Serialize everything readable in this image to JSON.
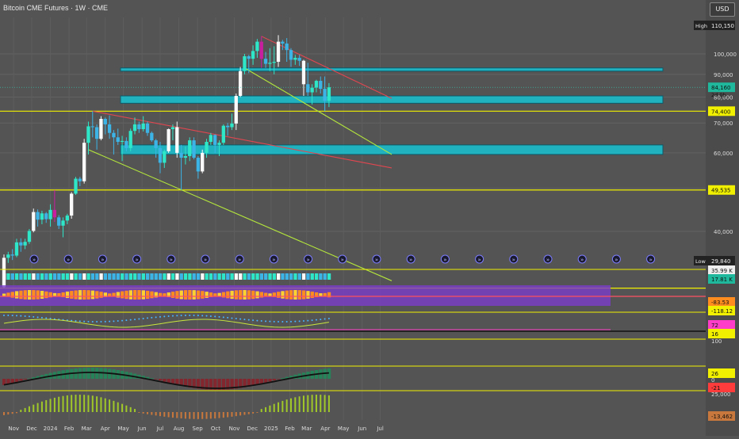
{
  "header": {
    "title": "Bitcoin CME Futures · 1W · CME",
    "currency": "USD"
  },
  "colors": {
    "background": "#545454",
    "bull": "#2ee6c8",
    "bear": "#3cb4e6",
    "neutral_candle": "#fafafa",
    "magenta_candle": "#c81ea0",
    "yellow_line": "#f0f000",
    "red_line": "#e14650",
    "green_line": "#b4e63c",
    "zone_fill": "#19c3d2"
  },
  "chart_data": {
    "type": "candlestick",
    "title": "Bitcoin CME Futures · 1W · CME",
    "x_labels": [
      "Nov",
      "Dec",
      "2024",
      "Feb",
      "Mar",
      "Apr",
      "May",
      "Jun",
      "Jul",
      "Aug",
      "Sep",
      "Oct",
      "Nov",
      "Dec",
      "2025",
      "Feb",
      "Mar",
      "Apr",
      "May",
      "Jun",
      "Jul"
    ],
    "y_ticks": [
      40000,
      50000,
      60000,
      70000,
      80000,
      90000,
      100000
    ],
    "y_tick_labels": [
      "40,000",
      "50,000",
      "60,000",
      "70,000",
      "80,000",
      "90,000",
      "100,000"
    ],
    "log_scale": true,
    "grid": true,
    "price_labels": [
      {
        "label": "High",
        "value": "110,150"
      },
      {
        "label": "",
        "value": "84,160"
      },
      {
        "label": "",
        "value": "2d 0h"
      },
      {
        "label": "",
        "value": "74,400"
      },
      {
        "label": "",
        "value": "49,535"
      },
      {
        "label": "Low",
        "value": "29,840"
      }
    ],
    "horizontal_lines": [
      74400,
      49535,
      29840
    ],
    "zones": [
      {
        "low": 91500,
        "high": 93000
      },
      {
        "low": 77500,
        "high": 80500
      },
      {
        "low": 59500,
        "high": 62500
      }
    ],
    "candles": [
      {
        "date": "2023-10-16",
        "o": 30000,
        "h": 35500,
        "l": 29840,
        "c": 34900
      },
      {
        "date": "2023-10-23",
        "o": 34900,
        "h": 36000,
        "l": 34000,
        "c": 35500
      },
      {
        "date": "2023-10-30",
        "o": 35500,
        "h": 36500,
        "l": 34500,
        "c": 35300
      },
      {
        "date": "2023-11-06",
        "o": 35300,
        "h": 38500,
        "l": 35000,
        "c": 37800
      },
      {
        "date": "2023-11-13",
        "o": 37800,
        "h": 38600,
        "l": 36000,
        "c": 37200
      },
      {
        "date": "2023-11-20",
        "o": 37200,
        "h": 38500,
        "l": 36500,
        "c": 37900
      },
      {
        "date": "2023-11-27",
        "o": 37900,
        "h": 40500,
        "l": 37500,
        "c": 40100
      },
      {
        "date": "2023-12-04",
        "o": 40100,
        "h": 45000,
        "l": 39800,
        "c": 44200
      },
      {
        "date": "2023-12-11",
        "o": 44200,
        "h": 44800,
        "l": 41000,
        "c": 42500
      },
      {
        "date": "2023-12-18",
        "o": 42500,
        "h": 44500,
        "l": 41500,
        "c": 43900
      },
      {
        "date": "2023-12-25",
        "o": 43900,
        "h": 44200,
        "l": 41800,
        "c": 42600
      },
      {
        "date": "2024-01-01",
        "o": 42600,
        "h": 46000,
        "l": 41000,
        "c": 44700
      },
      {
        "date": "2024-01-08",
        "o": 44700,
        "h": 49500,
        "l": 42000,
        "c": 43000
      },
      {
        "date": "2024-01-15",
        "o": 43000,
        "h": 43500,
        "l": 40500,
        "c": 41200
      },
      {
        "date": "2024-01-22",
        "o": 41200,
        "h": 43000,
        "l": 38800,
        "c": 42300
      },
      {
        "date": "2024-01-29",
        "o": 42300,
        "h": 43800,
        "l": 41500,
        "c": 43400
      },
      {
        "date": "2024-02-05",
        "o": 43400,
        "h": 49000,
        "l": 42700,
        "c": 48600
      },
      {
        "date": "2024-02-12",
        "o": 48600,
        "h": 53000,
        "l": 48300,
        "c": 52500
      },
      {
        "date": "2024-02-19",
        "o": 52500,
        "h": 53000,
        "l": 50500,
        "c": 51800
      },
      {
        "date": "2024-02-26",
        "o": 51800,
        "h": 64500,
        "l": 51200,
        "c": 63200
      },
      {
        "date": "2024-03-04",
        "o": 63200,
        "h": 70500,
        "l": 59500,
        "c": 68800
      },
      {
        "date": "2024-03-11",
        "o": 68800,
        "h": 74400,
        "l": 65000,
        "c": 68500
      },
      {
        "date": "2024-03-18",
        "o": 68500,
        "h": 69500,
        "l": 61000,
        "c": 64500
      },
      {
        "date": "2024-03-25",
        "o": 64500,
        "h": 72500,
        "l": 64000,
        "c": 71500
      },
      {
        "date": "2024-04-01",
        "o": 71500,
        "h": 72000,
        "l": 66000,
        "c": 69500
      },
      {
        "date": "2024-04-08",
        "o": 69500,
        "h": 72800,
        "l": 64500,
        "c": 66500
      },
      {
        "date": "2024-04-15",
        "o": 66500,
        "h": 67500,
        "l": 59500,
        "c": 65000
      },
      {
        "date": "2024-04-22",
        "o": 65000,
        "h": 68000,
        "l": 62500,
        "c": 63500
      },
      {
        "date": "2024-04-29",
        "o": 63500,
        "h": 65500,
        "l": 57500,
        "c": 63800
      },
      {
        "date": "2024-05-06",
        "o": 63800,
        "h": 65000,
        "l": 60500,
        "c": 61500
      },
      {
        "date": "2024-05-13",
        "o": 61500,
        "h": 68000,
        "l": 60500,
        "c": 67200
      },
      {
        "date": "2024-05-20",
        "o": 67200,
        "h": 72000,
        "l": 66000,
        "c": 69500
      },
      {
        "date": "2024-05-27",
        "o": 69500,
        "h": 70500,
        "l": 66500,
        "c": 67800
      },
      {
        "date": "2024-06-03",
        "o": 67800,
        "h": 72500,
        "l": 67000,
        "c": 69800
      },
      {
        "date": "2024-06-10",
        "o": 69800,
        "h": 70500,
        "l": 65500,
        "c": 66500
      },
      {
        "date": "2024-06-17",
        "o": 66500,
        "h": 67000,
        "l": 63500,
        "c": 64000
      },
      {
        "date": "2024-06-24",
        "o": 64000,
        "h": 64500,
        "l": 58500,
        "c": 61500
      },
      {
        "date": "2024-07-01",
        "o": 61500,
        "h": 63500,
        "l": 54000,
        "c": 57000
      },
      {
        "date": "2024-07-08",
        "o": 57000,
        "h": 61000,
        "l": 55500,
        "c": 60500
      },
      {
        "date": "2024-07-15",
        "o": 60500,
        "h": 68000,
        "l": 60000,
        "c": 67800
      },
      {
        "date": "2024-07-22",
        "o": 67800,
        "h": 69500,
        "l": 64000,
        "c": 68500
      },
      {
        "date": "2024-07-29",
        "o": 68500,
        "h": 70500,
        "l": 58500,
        "c": 60000
      },
      {
        "date": "2024-08-05",
        "o": 60000,
        "h": 62500,
        "l": 49535,
        "c": 58500
      },
      {
        "date": "2024-08-12",
        "o": 58500,
        "h": 62000,
        "l": 56500,
        "c": 59000
      },
      {
        "date": "2024-08-19",
        "o": 59000,
        "h": 65000,
        "l": 57500,
        "c": 64000
      },
      {
        "date": "2024-08-26",
        "o": 64000,
        "h": 65000,
        "l": 58000,
        "c": 58500
      },
      {
        "date": "2024-09-02",
        "o": 58500,
        "h": 59000,
        "l": 52500,
        "c": 54500
      },
      {
        "date": "2024-09-09",
        "o": 54500,
        "h": 61000,
        "l": 54000,
        "c": 60000
      },
      {
        "date": "2024-09-16",
        "o": 60000,
        "h": 64500,
        "l": 58500,
        "c": 63500
      },
      {
        "date": "2024-09-23",
        "o": 63500,
        "h": 66500,
        "l": 62500,
        "c": 65800
      },
      {
        "date": "2024-09-30",
        "o": 65800,
        "h": 66000,
        "l": 60000,
        "c": 62500
      },
      {
        "date": "2024-10-07",
        "o": 62500,
        "h": 64000,
        "l": 59000,
        "c": 63200
      },
      {
        "date": "2024-10-14",
        "o": 63200,
        "h": 69500,
        "l": 62500,
        "c": 69000
      },
      {
        "date": "2024-10-21",
        "o": 69000,
        "h": 70000,
        "l": 65500,
        "c": 68500
      },
      {
        "date": "2024-10-28",
        "o": 68500,
        "h": 73500,
        "l": 67500,
        "c": 69800
      },
      {
        "date": "2024-11-04",
        "o": 69800,
        "h": 81500,
        "l": 67500,
        "c": 80500
      },
      {
        "date": "2024-11-11",
        "o": 80500,
        "h": 93500,
        "l": 80000,
        "c": 91500
      },
      {
        "date": "2024-11-18",
        "o": 91500,
        "h": 100000,
        "l": 90000,
        "c": 98800
      },
      {
        "date": "2024-11-25",
        "o": 98800,
        "h": 99500,
        "l": 90500,
        "c": 97500
      },
      {
        "date": "2024-12-02",
        "o": 97500,
        "h": 104500,
        "l": 94500,
        "c": 101500
      },
      {
        "date": "2024-12-09",
        "o": 101500,
        "h": 108000,
        "l": 98000,
        "c": 106500
      },
      {
        "date": "2024-12-16",
        "o": 106500,
        "h": 109500,
        "l": 93000,
        "c": 97500
      },
      {
        "date": "2024-12-23",
        "o": 97500,
        "h": 101000,
        "l": 93000,
        "c": 95000
      },
      {
        "date": "2024-12-30",
        "o": 95000,
        "h": 103000,
        "l": 91500,
        "c": 95500
      },
      {
        "date": "2025-01-06",
        "o": 95500,
        "h": 104000,
        "l": 90000,
        "c": 96000
      },
      {
        "date": "2025-01-13",
        "o": 96000,
        "h": 110150,
        "l": 93500,
        "c": 106500
      },
      {
        "date": "2025-01-20",
        "o": 106500,
        "h": 107500,
        "l": 102000,
        "c": 105500
      },
      {
        "date": "2025-01-27",
        "o": 105500,
        "h": 108500,
        "l": 96000,
        "c": 102000
      },
      {
        "date": "2025-02-03",
        "o": 102000,
        "h": 103000,
        "l": 93500,
        "c": 97000
      },
      {
        "date": "2025-02-10",
        "o": 97000,
        "h": 99500,
        "l": 94500,
        "c": 98000
      },
      {
        "date": "2025-02-17",
        "o": 98000,
        "h": 99500,
        "l": 94000,
        "c": 96500
      },
      {
        "date": "2025-02-24",
        "o": 96500,
        "h": 97000,
        "l": 80500,
        "c": 85500
      },
      {
        "date": "2025-03-03",
        "o": 85500,
        "h": 95500,
        "l": 80500,
        "c": 82000
      },
      {
        "date": "2025-03-10",
        "o": 82000,
        "h": 85500,
        "l": 77000,
        "c": 84000
      },
      {
        "date": "2025-03-17",
        "o": 84000,
        "h": 87500,
        "l": 82000,
        "c": 87000
      },
      {
        "date": "2025-03-24",
        "o": 87000,
        "h": 89000,
        "l": 81500,
        "c": 83500
      },
      {
        "date": "2025-03-31",
        "o": 83500,
        "h": 89000,
        "l": 74400,
        "c": 78500
      },
      {
        "date": "2025-04-07",
        "o": 78500,
        "h": 86000,
        "l": 76000,
        "c": 84160
      }
    ],
    "indicators": [
      {
        "name": "volume",
        "labels": [
          "35.99 K",
          "17.81 K"
        ],
        "ylim": [
          0,
          40000
        ]
      },
      {
        "name": "oscillator",
        "labels": [
          "-83.53",
          "-118.12"
        ]
      },
      {
        "name": "momentum",
        "labels": [
          "72",
          "16",
          "100"
        ],
        "ylim": [
          0,
          100
        ]
      },
      {
        "name": "macd",
        "labels": [
          "26",
          "0",
          "-21"
        ]
      },
      {
        "name": "histogram",
        "labels": [
          "25,000",
          "-13,462"
        ]
      }
    ]
  }
}
